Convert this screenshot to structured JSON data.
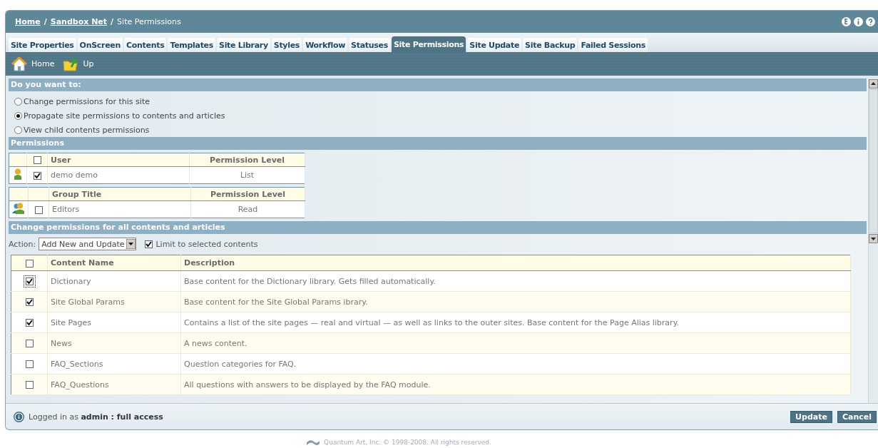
{
  "breadcrumb": {
    "separator": "/",
    "items": [
      {
        "label": "Home",
        "link": true
      },
      {
        "label": "Sandbox Net",
        "link": true
      },
      {
        "label": "Site Permissions",
        "link": false
      }
    ]
  },
  "tabs": [
    {
      "label": "Site Properties",
      "selected": false
    },
    {
      "label": "OnScreen",
      "selected": false
    },
    {
      "label": "Contents",
      "selected": false
    },
    {
      "label": "Templates",
      "selected": false
    },
    {
      "label": "Site Library",
      "selected": false
    },
    {
      "label": "Styles",
      "selected": false
    },
    {
      "label": "Workflow",
      "selected": false
    },
    {
      "label": "Statuses",
      "selected": false
    },
    {
      "label": "Site Permissions",
      "selected": true
    },
    {
      "label": "Site Update",
      "selected": false
    },
    {
      "label": "Site Backup",
      "selected": false
    },
    {
      "label": "Failed Sessions",
      "selected": false
    }
  ],
  "toolbar": [
    {
      "label": "Home",
      "kind": "home"
    },
    {
      "label": "Up",
      "kind": "up"
    }
  ],
  "choice": {
    "title": "Do you want to:",
    "options": [
      {
        "label": "Change permissions for this site",
        "selected": false
      },
      {
        "label": "Propagate site permissions to contents and articles",
        "selected": true
      },
      {
        "label": "View child contents permissions",
        "selected": false
      }
    ]
  },
  "permissions": {
    "title": "Permissions",
    "tables": [
      {
        "kind": "user",
        "columns": [
          "User",
          "Permission Level"
        ],
        "all_checked": false,
        "rows": [
          {
            "name": "demo demo",
            "level": "List",
            "checked": true
          }
        ]
      },
      {
        "kind": "group",
        "columns": [
          "Group Title",
          "Permission Level"
        ],
        "rows": [
          {
            "name": "Editors",
            "level": "Read",
            "checked": false
          }
        ]
      }
    ]
  },
  "change": {
    "title": "Change permissions for all contents and articles",
    "action_label": "Action:",
    "action_value": "Add New and Update",
    "limit": {
      "label": "Limit to selected contents",
      "checked": true
    },
    "columns": [
      "Content Name",
      "Description"
    ],
    "all_checked": false,
    "rows": [
      {
        "name": "Dictionary",
        "description": "Base content for the Dictionary library. Gets filled automatically.",
        "checked": true,
        "focused": true
      },
      {
        "name": "Site Global Params",
        "description": "Base content for the Site Global Params ibrary.",
        "checked": true,
        "focused": false
      },
      {
        "name": "Site Pages",
        "description": "Contains a list of the site pages — real and virtual — as well as links to the outer sites. Base content for the Page Alias library.",
        "checked": true,
        "focused": false
      },
      {
        "name": "News",
        "description": "A news content.",
        "checked": false,
        "focused": false
      },
      {
        "name": "FAQ_Sections",
        "description": "Question categories for FAQ.",
        "checked": false,
        "focused": false
      },
      {
        "name": "FAQ_Questions",
        "description": "All questions with answers to be displayed by the FAQ module.",
        "checked": false,
        "focused": false
      }
    ]
  },
  "status_bar": {
    "text": "Logged in as **admin : full access**",
    "buttons": [
      "Update",
      "Cancel"
    ]
  },
  "footer": "Quantum Art, Inc. © 1998-2008. All rights reserved."
}
